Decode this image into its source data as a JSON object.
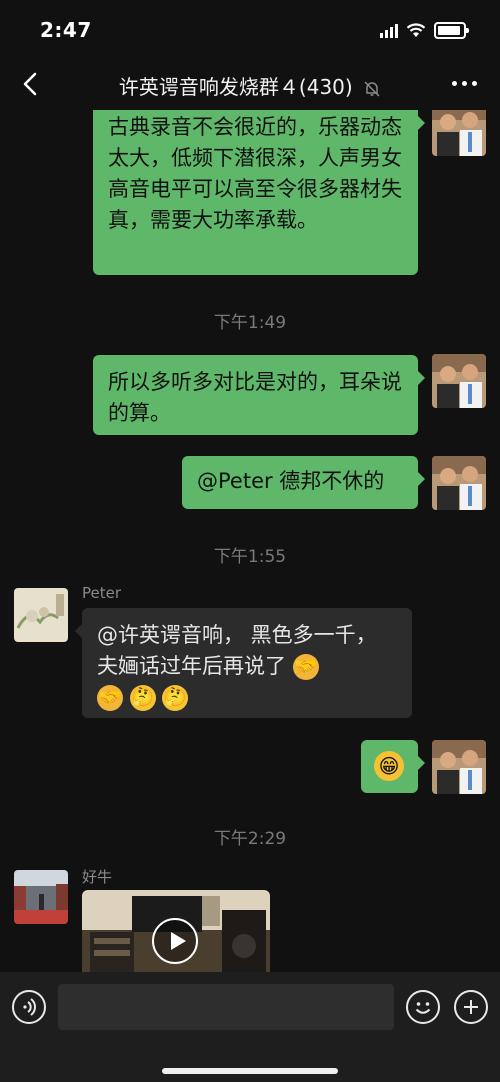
{
  "status": {
    "time": "2:47"
  },
  "nav": {
    "title": "许英谔音响发烧群４(430)"
  },
  "messages": {
    "m1": "古典录音不会很近的，乐器动态太大，低频下潜很深，人声男女高音电平可以高至令很多器材失真，需要大功率承载。",
    "t1": "下午1:49",
    "m2": "所以多听多对比是对的，耳朵说的算。",
    "m3": "@Peter 德邦不休的",
    "t2": "下午1:55",
    "peter_name": "Peter",
    "m4_text": "@许英谔音响， 黑色多一千，夫婳话过年后再说了",
    "m4_emoji": [
      "handshake",
      "handshake",
      "thinking",
      "thinking"
    ],
    "m5_emoji": "grin",
    "t3": "下午2:29",
    "haoniu_name": "好牛"
  },
  "input": {
    "placeholder": ""
  },
  "icons": {
    "back": "chevron-left-icon",
    "mute": "bell-off-icon",
    "more": "more-dots-icon",
    "voice": "voice-icon",
    "emoji": "emoji-icon",
    "plus": "plus-icon",
    "play": "play-icon"
  },
  "colors": {
    "outgoing": "#5fb86a",
    "incoming": "#2c2c2c",
    "background": "#111111"
  }
}
